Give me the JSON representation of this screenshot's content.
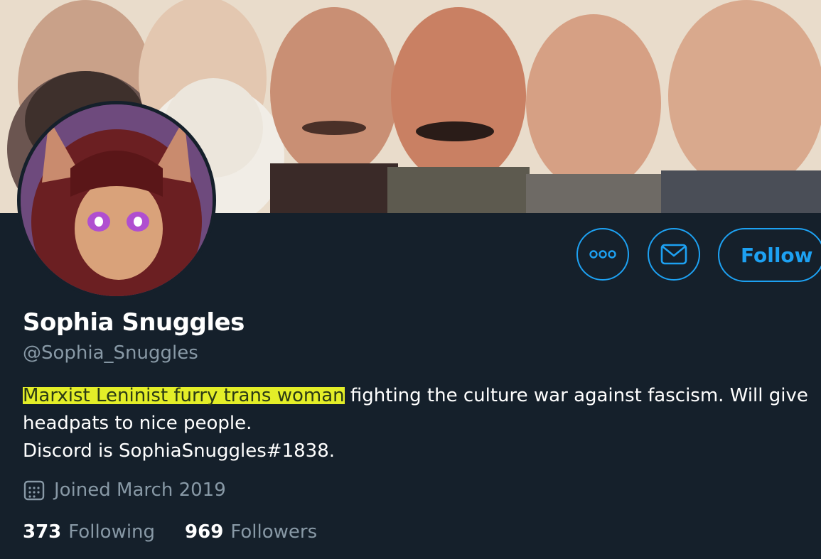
{
  "profile": {
    "display_name": "Sophia Snuggles",
    "handle": "@Sophia_Snuggles",
    "bio_highlight": "Marxist Leninist furry trans woman",
    "bio_rest_line1": " fighting the culture war against fascism. Will give",
    "bio_line2": "headpats to nice people.",
    "bio_line3": "Discord is SophiaSnuggles#1838.",
    "joined": "Joined March 2019"
  },
  "actions": {
    "more_icon": "more-icon",
    "message_icon": "envelope-icon",
    "follow_label": "Follow"
  },
  "stats": {
    "following_count": "373",
    "following_label": "Following",
    "followers_count": "969",
    "followers_label": "Followers"
  },
  "colors": {
    "background": "#15202b",
    "accent": "#1da1f2",
    "muted": "#8899a6",
    "highlight": "#f5ff28"
  }
}
